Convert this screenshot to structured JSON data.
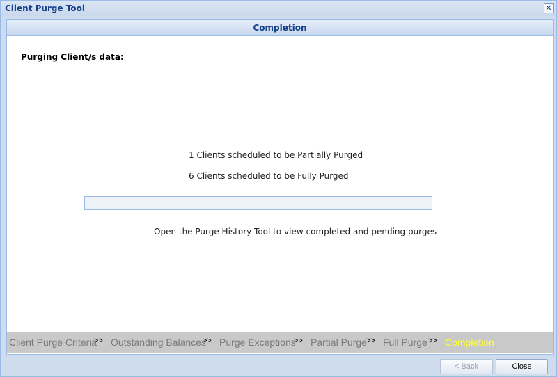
{
  "window": {
    "title": "Client Purge Tool"
  },
  "panel": {
    "header": "Completion",
    "heading": "Purging Client/s data:",
    "lines": [
      "1 Clients scheduled to be Partially Purged",
      "6 Clients scheduled to be Fully Purged"
    ],
    "progress": 0,
    "footer_note": "Open the Purge History Tool to view completed and pending purges"
  },
  "steps": {
    "separator": ">>",
    "items": [
      "Client Purge Criteria",
      "Outstanding Balances",
      "Purge Exceptions",
      "Partial Purge",
      "Full Purge",
      "Completion"
    ],
    "active_index": 5
  },
  "buttons": {
    "back": "< Back",
    "close": "Close"
  }
}
